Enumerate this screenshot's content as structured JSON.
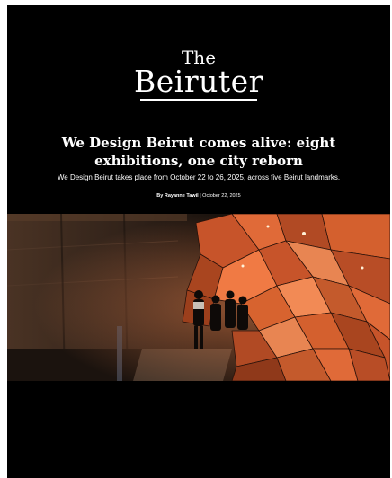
{
  "brand": {
    "logo_line1": "The",
    "logo_line2": "Beiruter"
  },
  "article": {
    "headline": "We Design Beirut comes alive: eight exhibitions, one city reborn",
    "subheadline": "We Design Beirut takes place from October 22 to 26, 2025, across five Beirut landmarks.",
    "byline_prefix": "By",
    "author": "Rayanne Tawil",
    "separator": "|",
    "date": "October 22, 2025"
  },
  "hero_image": {
    "subject": "illuminated copper faceted installation inside a dark industrial hall with visitors",
    "colors": {
      "copper": "#c7542a",
      "copper_bright": "#f07a44",
      "wall": "#3a2a20",
      "shadow": "#120c09"
    }
  },
  "colors": {
    "background": "#000000",
    "text": "#ffffff",
    "page_margin": "#ffffff"
  }
}
